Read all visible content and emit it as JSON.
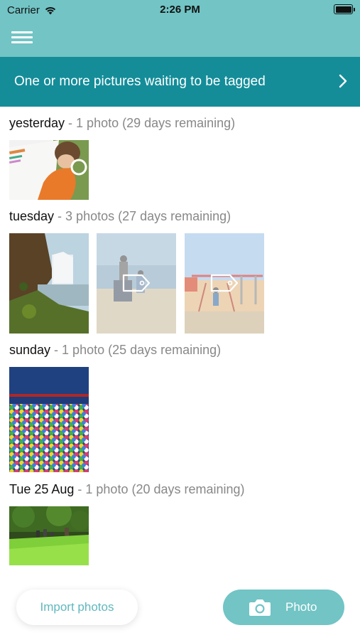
{
  "status_bar": {
    "carrier": "Carrier",
    "time": "2:26 PM"
  },
  "banner": {
    "text": "One or more pictures waiting to be tagged"
  },
  "sections": [
    {
      "day": "yesterday",
      "summary": " - 1 photo (29 days remaining)"
    },
    {
      "day": "tuesday",
      "summary": " - 3 photos (27 days remaining)"
    },
    {
      "day": "sunday",
      "summary": " - 1 photo (25 days remaining)"
    },
    {
      "day": "Tue 25 Aug",
      "summary": " - 1 photo (20 days remaining)"
    }
  ],
  "actions": {
    "import_label": "Import photos",
    "photo_label": "Photo"
  },
  "icons": [
    "wifi-icon",
    "battery-icon",
    "menu-icon",
    "chevron-right-icon",
    "tag-icon",
    "camera-icon"
  ],
  "colors": {
    "header": "#72c4c5",
    "banner": "#148d99",
    "accent_text": "#5fb8bd"
  }
}
